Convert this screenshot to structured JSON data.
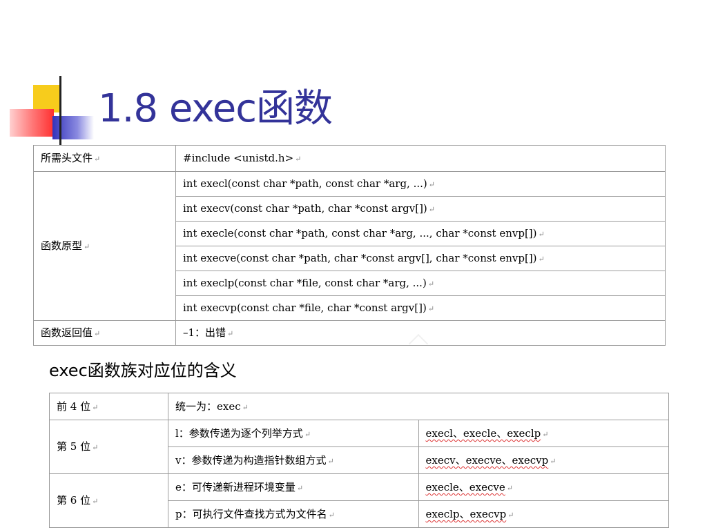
{
  "slide": {
    "title": "1.8 exec函数",
    "subtitle": "exec函数族对应位的含义"
  },
  "table1": {
    "header_label": "所需头文件",
    "header_value": "#include <unistd.h>",
    "proto_label": "函数原型",
    "prototypes": [
      "int execl(const char *path, const char *arg, ...)",
      "int execv(const char *path, char *const argv[])",
      "int execle(const char *path, const char *arg, ..., char *const envp[])",
      "int execve(const char *path, char *const argv[], char *const envp[])",
      "int execlp(const char *file, const char *arg, ...)",
      "int execvp(const char *file, char *const argv[])"
    ],
    "return_label": "函数返回值",
    "return_value": "–1：出错"
  },
  "table2": {
    "rows": [
      {
        "pos": "前 4 位",
        "meaning": "统一为：exec",
        "funcs": ""
      },
      {
        "pos": "第 5 位",
        "meaning": "l：参数传递为逐个列举方式",
        "funcs": "execl、execle、execlp"
      },
      {
        "pos": "",
        "meaning": "v：参数传递为构造指针数组方式",
        "funcs": "execv、execve、execvp"
      },
      {
        "pos": "第 6 位",
        "meaning": "e：可传递新进程环境变量",
        "funcs": "execle、execve"
      },
      {
        "pos": "",
        "meaning": "p：可执行文件查找方式为文件名",
        "funcs": "execlp、execvp"
      }
    ]
  },
  "colors": {
    "title": "#333399",
    "border": "#9a9a9a"
  }
}
